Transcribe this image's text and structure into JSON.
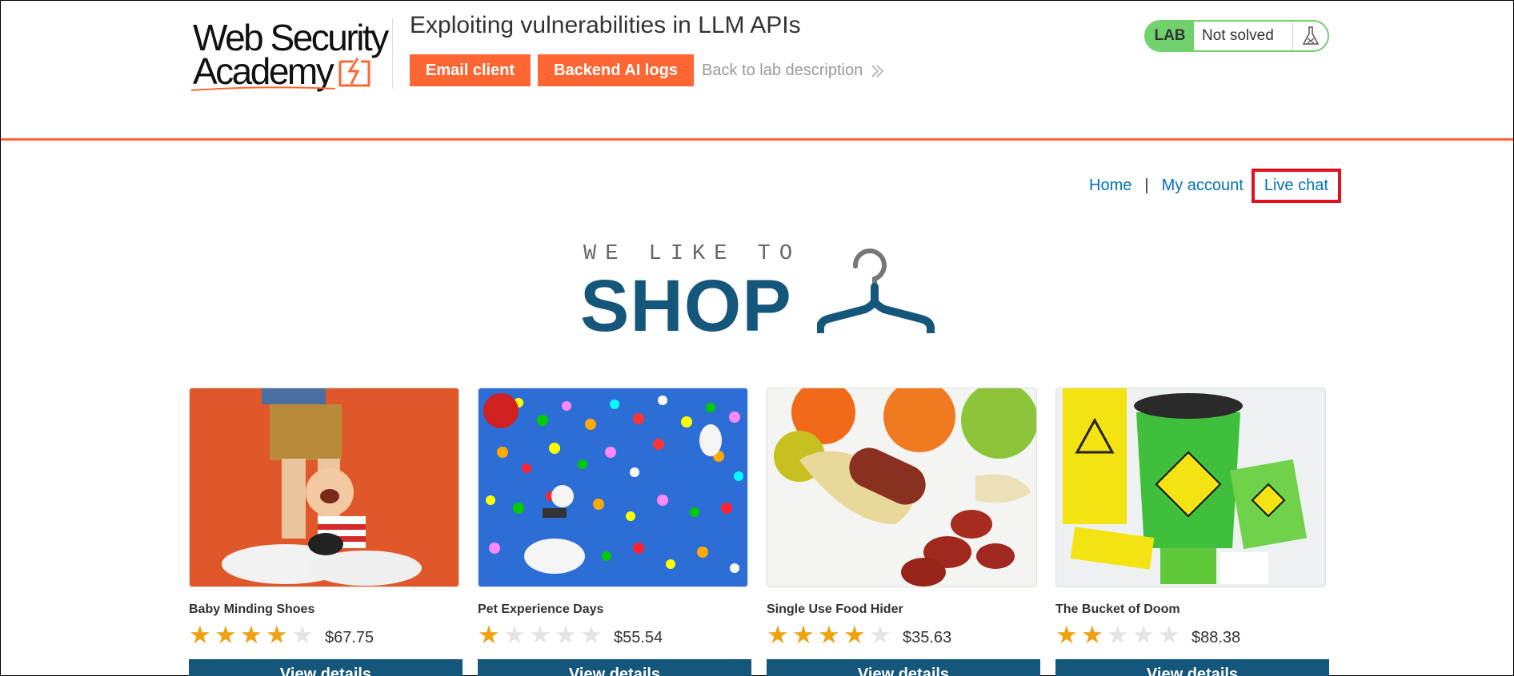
{
  "academy": {
    "logo_line1": "Web Security",
    "logo_line2": "Academy",
    "lab_title": "Exploiting vulnerabilities in LLM APIs",
    "email_client": "Email client",
    "backend_logs": "Backend AI logs",
    "back_link": "Back to lab description",
    "lab_label": "LAB",
    "lab_state": "Not solved"
  },
  "nav": {
    "home": "Home",
    "separator": "|",
    "my_account": "My account",
    "live_chat": "Live chat"
  },
  "hero": {
    "tagline": "WE LIKE TO",
    "shop": "SHOP"
  },
  "colors": {
    "accent_orange": "#ff6633",
    "brand_blue": "#15577b",
    "lab_green": "#70d16d",
    "link_blue": "#0071bc",
    "highlight_red": "#e3101f",
    "star": "#f0a10f"
  },
  "products": [
    {
      "name": "Baby Minding Shoes",
      "rating": 4,
      "price": "$67.75",
      "button": "View details"
    },
    {
      "name": "Pet Experience Days",
      "rating": 1,
      "price": "$55.54",
      "button": "View details"
    },
    {
      "name": "Single Use Food Hider",
      "rating": 4,
      "price": "$35.63",
      "button": "View details"
    },
    {
      "name": "The Bucket of Doom",
      "rating": 2,
      "price": "$88.38",
      "button": "View details"
    }
  ]
}
